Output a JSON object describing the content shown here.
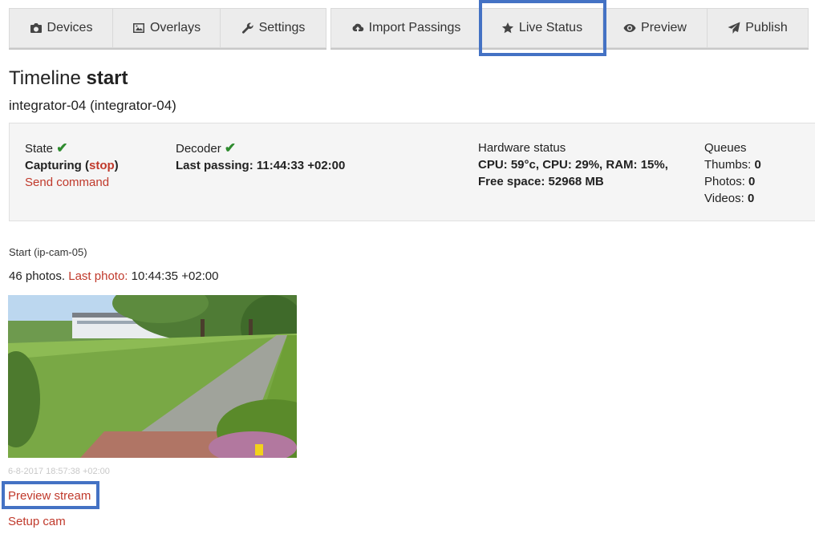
{
  "nav": {
    "group1": [
      {
        "label": "Devices",
        "icon": "camera-icon"
      },
      {
        "label": "Overlays",
        "icon": "picture-icon"
      },
      {
        "label": "Settings",
        "icon": "wrench-icon"
      }
    ],
    "group2": [
      {
        "label": "Import Passings",
        "icon": "cloud-upload-icon"
      },
      {
        "label": "Live Status",
        "icon": "star-icon"
      },
      {
        "label": "Preview",
        "icon": "eye-icon"
      },
      {
        "label": "Publish",
        "icon": "send-icon"
      }
    ]
  },
  "page": {
    "title_prefix": "Timeline",
    "title_bold": "start",
    "subtitle": "integrator-04 (integrator-04)"
  },
  "status": {
    "state_label": "State",
    "state_value": "Capturing",
    "state_paren_open": "(",
    "state_action": "stop",
    "state_paren_close": ")",
    "send_command": "Send command",
    "decoder_label": "Decoder",
    "last_passing": "Last passing: 11:44:33 +02:00",
    "hardware_label": "Hardware status",
    "hardware_line1": "CPU: 59°c, CPU: 29%, RAM: 15%,",
    "hardware_line2": "Free space: 52968 MB",
    "queues_label": "Queues",
    "thumbs_label": "Thumbs:",
    "thumbs_value": "0",
    "photos_label": "Photos:",
    "photos_value": "0",
    "videos_label": "Videos:",
    "videos_value": "0"
  },
  "camera": {
    "title": "Start (ip-cam-05)",
    "photo_count": "46 photos.",
    "last_photo_label": "Last photo:",
    "last_photo_time": "10:44:35 +02:00",
    "timestamp": "6-8-2017 18:57:38 +02:00",
    "preview_stream": "Preview stream",
    "setup_cam": "Setup cam"
  },
  "colors": {
    "link_red": "#c0392b",
    "check_green": "#2e8b2e",
    "highlight_blue": "#4472c4"
  }
}
